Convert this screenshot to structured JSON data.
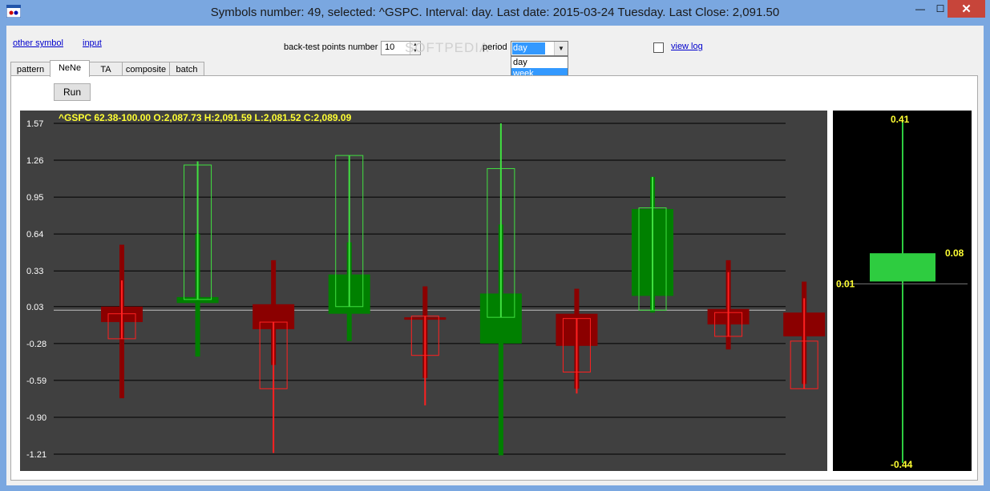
{
  "window": {
    "title": "Symbols number: 49, selected:  ^GSPC. Interval: day.  Last date: 2015-03-24 Tuesday.  Last Close: 2,091.50",
    "close_glyph": "✕",
    "min_glyph": "—",
    "max_glyph": "☐"
  },
  "top": {
    "other_symbol": "other symbol",
    "input": "input",
    "backtest_label": "back-test points number",
    "backtest_value": "10",
    "period_label": "period",
    "period_value": "day",
    "period_options": [
      "day",
      "week"
    ],
    "view_log": "view log",
    "watermark": "SOFTPEDIA"
  },
  "tabs": [
    {
      "label": "pattern"
    },
    {
      "label": "NeNe"
    },
    {
      "label": "TA"
    },
    {
      "label": "composite"
    },
    {
      "label": "batch"
    }
  ],
  "run_label": "Run",
  "chart_data": {
    "type": "candlestick",
    "header": "^GSPC  62.38-100.00   O:2,087.73   H:2,091.59   L:2,081.52   C:2,089.09",
    "y_ticks": [
      "1.57",
      "1.26",
      "0.95",
      "0.64",
      "0.33",
      "0.03",
      "-0.28",
      "-0.59",
      "-0.90",
      "-1.21"
    ],
    "ylim": [
      -1.21,
      1.57
    ],
    "baseline": 0.0,
    "series": [
      {
        "name": "filled",
        "candles": [
          {
            "open": 0.03,
            "close": -0.1,
            "high": 0.55,
            "low": -0.74,
            "color": "#8b0000"
          },
          {
            "open": 0.06,
            "close": 0.11,
            "high": 0.64,
            "low": -0.39,
            "color": "#008000"
          },
          {
            "open": 0.05,
            "close": -0.16,
            "high": 0.42,
            "low": -0.46,
            "color": "#8b0000"
          },
          {
            "open": -0.03,
            "close": 0.3,
            "high": 0.57,
            "low": -0.26,
            "color": "#008000"
          },
          {
            "open": -0.06,
            "close": -0.06,
            "high": 0.2,
            "low": -0.57,
            "color": "#8b0000"
          },
          {
            "open": -0.28,
            "close": 0.14,
            "high": 0.72,
            "low": -1.22,
            "color": "#008000"
          },
          {
            "open": -0.03,
            "close": -0.3,
            "high": 0.18,
            "low": -0.66,
            "color": "#8b0000"
          },
          {
            "open": 0.12,
            "close": 0.85,
            "high": 1.12,
            "low": -0.02,
            "color": "#008000"
          },
          {
            "open": 0.01,
            "close": -0.12,
            "high": 0.42,
            "low": -0.33,
            "color": "#8b0000"
          },
          {
            "open": -0.02,
            "close": -0.22,
            "high": 0.24,
            "low": -0.62,
            "color": "#8b0000"
          }
        ]
      },
      {
        "name": "outline",
        "candles": [
          {
            "open": -0.03,
            "close": -0.24,
            "high": 0.25,
            "low": -0.24,
            "color": "#ff2020"
          },
          {
            "open": 0.09,
            "close": 1.22,
            "high": 1.25,
            "low": 0.09,
            "color": "#40e040"
          },
          {
            "open": -0.1,
            "close": -0.66,
            "high": -0.1,
            "low": -1.2,
            "color": "#ff2020"
          },
          {
            "open": 0.03,
            "close": 1.3,
            "high": 1.3,
            "low": 0.03,
            "color": "#40e040"
          },
          {
            "open": -0.05,
            "close": -0.38,
            "high": -0.05,
            "low": -0.8,
            "color": "#ff2020"
          },
          {
            "open": -0.06,
            "close": 1.19,
            "high": 1.57,
            "low": -0.06,
            "color": "#40e040"
          },
          {
            "open": -0.07,
            "close": -0.52,
            "high": -0.07,
            "low": -0.7,
            "color": "#ff2020"
          },
          {
            "open": 0.0,
            "close": 0.86,
            "high": 1.12,
            "low": 0.0,
            "color": "#40e040"
          },
          {
            "open": -0.02,
            "close": -0.22,
            "high": 0.32,
            "low": -0.22,
            "color": "#ff2020"
          },
          {
            "open": -0.26,
            "close": -0.66,
            "high": 0.1,
            "low": -0.66,
            "color": "#ff2020"
          }
        ]
      }
    ]
  },
  "side_chart": {
    "top_label": "0.41",
    "bottom_label": "-0.44",
    "left_label": "0.01",
    "right_label": "0.08",
    "ylim": [
      -0.44,
      0.41
    ],
    "box_low": 0.01,
    "box_high": 0.08,
    "box_color": "#2ecc40",
    "line_color": "#2ecc40",
    "label_color": "#ffff33"
  }
}
